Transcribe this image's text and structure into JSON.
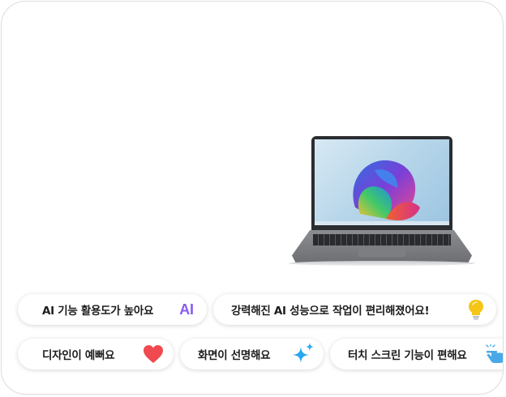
{
  "chips": [
    {
      "label": "AI 기능 활용도가 높아요",
      "icon_text": "AI",
      "icon": "ai-text-icon"
    },
    {
      "label": "강력해진 AI 성능으로 작업이 편리해졌어요!",
      "icon": "lightbulb-icon"
    },
    {
      "label": "디자인이 예뻐요",
      "icon": "heart-icon"
    },
    {
      "label": "화면이 선명해요",
      "icon": "sparkle-icon"
    },
    {
      "label": "터치 스크린 기능이 편해요",
      "icon": "touch-hand-icon"
    }
  ],
  "colors": {
    "ai_accent": "#8a5cf0",
    "bulb": "#f5c518",
    "heart": "#f0494f",
    "sparkle": "#27a9f0",
    "hand": "#4aa8e8"
  }
}
